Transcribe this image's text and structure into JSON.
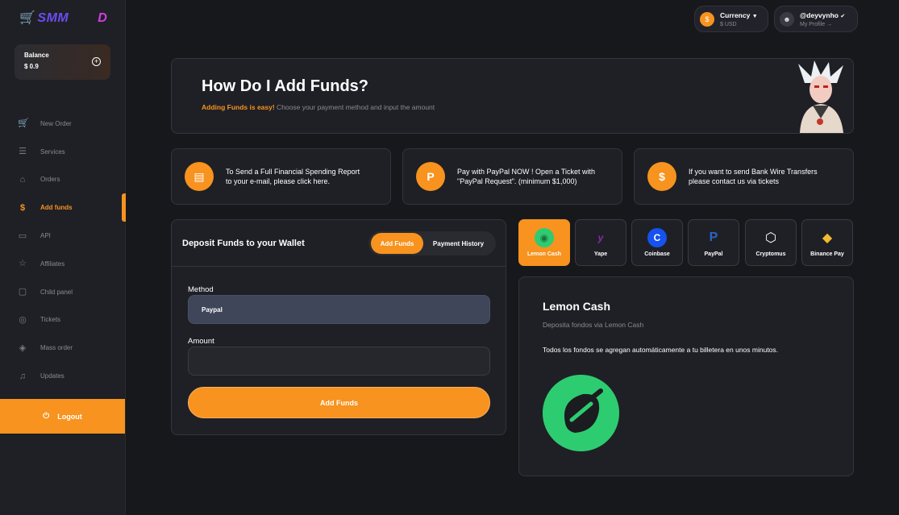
{
  "sidebar": {
    "logo_left": "SMM",
    "logo_right": "D",
    "balance_label": "Balance",
    "balance_value": "$ 0.9",
    "items": [
      {
        "label": "New Order",
        "icon": "cart-icon"
      },
      {
        "label": "Services",
        "icon": "list-icon"
      },
      {
        "label": "Orders",
        "icon": "basket-icon"
      },
      {
        "label": "Add funds",
        "icon": "dollar-circle-icon"
      },
      {
        "label": "API",
        "icon": "terminal-icon"
      },
      {
        "label": "Affiliates",
        "icon": "star-icon"
      },
      {
        "label": "Child panel",
        "icon": "window-icon"
      },
      {
        "label": "Tickets",
        "icon": "headset-icon"
      },
      {
        "label": "Mass order",
        "icon": "layers-icon"
      },
      {
        "label": "Updates",
        "icon": "bell-icon"
      }
    ],
    "logout_label": "Logout"
  },
  "header": {
    "currency_label": "Currency",
    "currency_value": "$ USD",
    "username": "@deyvynho",
    "profile_link": "My Profile"
  },
  "hero": {
    "title": "How Do I Add Funds?",
    "subtitle_highlight": "Adding Funds is easy!",
    "subtitle_rest": " Choose your payment method and input the amount"
  },
  "info_cards": [
    {
      "line1": "To Send a Full Financial Spending Report",
      "line2": "to your e-mail, please click here.",
      "icon": "report-icon"
    },
    {
      "line1": "Pay with PayPal NOW ! Open a Ticket with",
      "line2": "\"PayPal Request\". (minimum $1,000)",
      "icon": "paypal-icon"
    },
    {
      "line1": "If you want to send Bank Wire Transfers",
      "line2": "please contact us via tickets",
      "icon": "bank-icon"
    }
  ],
  "deposit": {
    "title": "Deposit Funds to your Wallet",
    "tab_add": "Add Funds",
    "tab_history": "Payment History",
    "method_label": "Method",
    "method_value": "Paypal",
    "amount_label": "Amount",
    "amount_value": "",
    "submit_label": "Add Funds"
  },
  "methods": [
    {
      "label": "Lemon Cash",
      "active": true
    },
    {
      "label": "Yape",
      "active": false
    },
    {
      "label": "Coinbase",
      "active": false
    },
    {
      "label": "PayPal",
      "active": false
    },
    {
      "label": "Cryptomus",
      "active": false
    },
    {
      "label": "Binance Pay",
      "active": false
    }
  ],
  "method_detail": {
    "title": "Lemon Cash",
    "subtitle": "Deposita fondos via Lemon Cash",
    "description": "Todos los fondos se agregan automáticamente a tu billetera en unos minutos."
  },
  "colors": {
    "accent": "#f7931e",
    "background": "#17181c",
    "card": "#1f2026",
    "lemon_green": "#2ecc71"
  }
}
